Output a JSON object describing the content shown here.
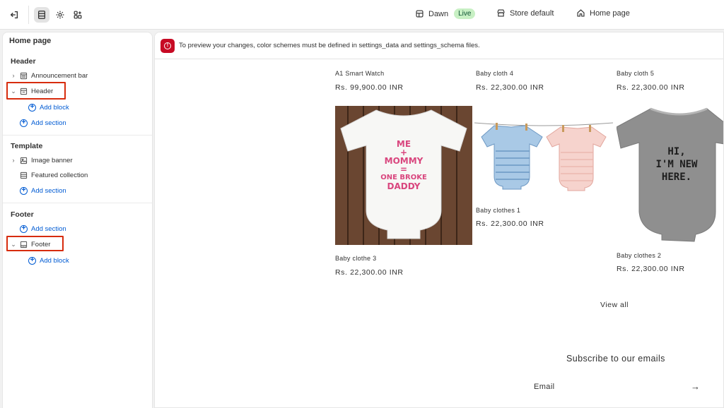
{
  "topbar": {
    "exit_icon": "exit-icon",
    "sections_icon": "sections-icon",
    "settings_icon": "gear-icon",
    "apps_icon": "apps-icon",
    "theme_name": "Dawn",
    "live_badge": "Live",
    "store_label": "Store default",
    "page_label": "Home page"
  },
  "sidebar": {
    "title": "Home page",
    "groups": [
      {
        "title": "Header"
      },
      {
        "title": "Template"
      },
      {
        "title": "Footer"
      }
    ],
    "header_items": [
      "Announcement bar",
      "Header"
    ],
    "template_items": [
      "Image banner",
      "Featured collection"
    ],
    "footer_items": [
      "Footer"
    ],
    "add_block": "Add block",
    "add_section": "Add section"
  },
  "banner": {
    "message": "To preview your changes, color schemes must be defined in settings_data and settings_schema files."
  },
  "products": [
    {
      "name": "A1 Smart Watch",
      "price": "Rs. 99,900.00 INR"
    },
    {
      "name": "Baby cloth 4",
      "price": "Rs. 22,300.00 INR"
    },
    {
      "name": "Baby cloth 5",
      "price": "Rs. 22,300.00 INR"
    },
    {
      "name": "Baby clothe 3",
      "price": "Rs. 22,300.00 INR",
      "image_text": [
        "ME",
        "+",
        "MOMMY",
        "=",
        "ONE BROKE",
        "DADDY"
      ]
    },
    {
      "name": "Baby clothes 1",
      "price": "Rs. 22,300.00 INR"
    },
    {
      "name": "Baby clothes 2",
      "price": "Rs. 22,300.00 INR",
      "image_text": [
        "HI,",
        "I'M NEW",
        "HERE."
      ]
    }
  ],
  "view_all": "View all",
  "subscribe_title": "Subscribe to our emails",
  "email_label": "Email",
  "colors": {
    "accent": "#005bd3",
    "critical": "#c70a24",
    "highlight": "#d72c0d",
    "live": "#c8f0c4"
  }
}
